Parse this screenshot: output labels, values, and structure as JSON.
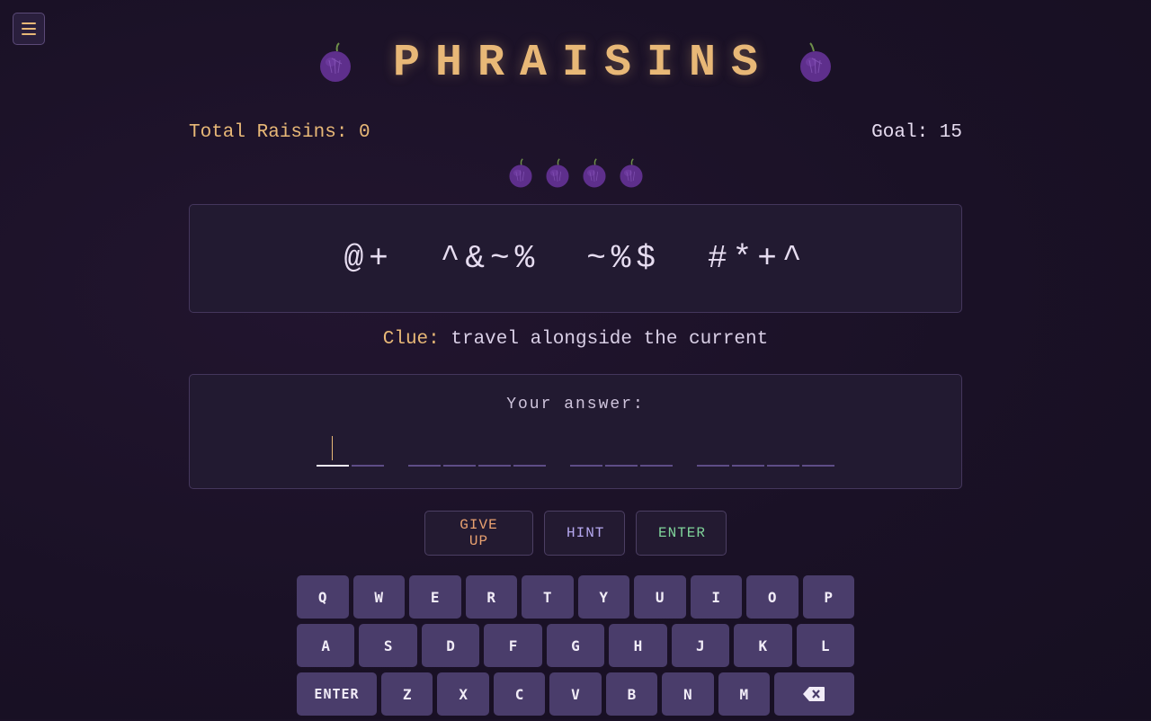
{
  "header": {
    "menu_icon": "hamburger-menu-icon",
    "title": "PHRAISINS",
    "title_icon": "raisin-icon",
    "accent_color": "#e8b877"
  },
  "stats": {
    "total": "Total Raisins: 0",
    "goal": "Goal: 15",
    "lives_remaining": 4
  },
  "puzzle": {
    "cipher_words": [
      "@+",
      "^&~%",
      "~%$",
      "#*+^"
    ],
    "clue_label": "Clue:",
    "clue_text": "travel alongside the current"
  },
  "answer": {
    "label": "Your answer:",
    "word_lengths": [
      2,
      4,
      3,
      4
    ],
    "active_slot": 0
  },
  "actions": {
    "give_up": "GIVE UP",
    "hint": "HINT",
    "enter": "ENTER"
  },
  "keyboard": {
    "row1": [
      "Q",
      "W",
      "E",
      "R",
      "T",
      "Y",
      "U",
      "I",
      "O",
      "P"
    ],
    "row2": [
      "A",
      "S",
      "D",
      "F",
      "G",
      "H",
      "J",
      "K",
      "L"
    ],
    "row3": [
      "ENTER",
      "Z",
      "X",
      "C",
      "V",
      "B",
      "N",
      "M",
      "BACKSPACE"
    ],
    "backspace_icon": "backspace-icon"
  }
}
